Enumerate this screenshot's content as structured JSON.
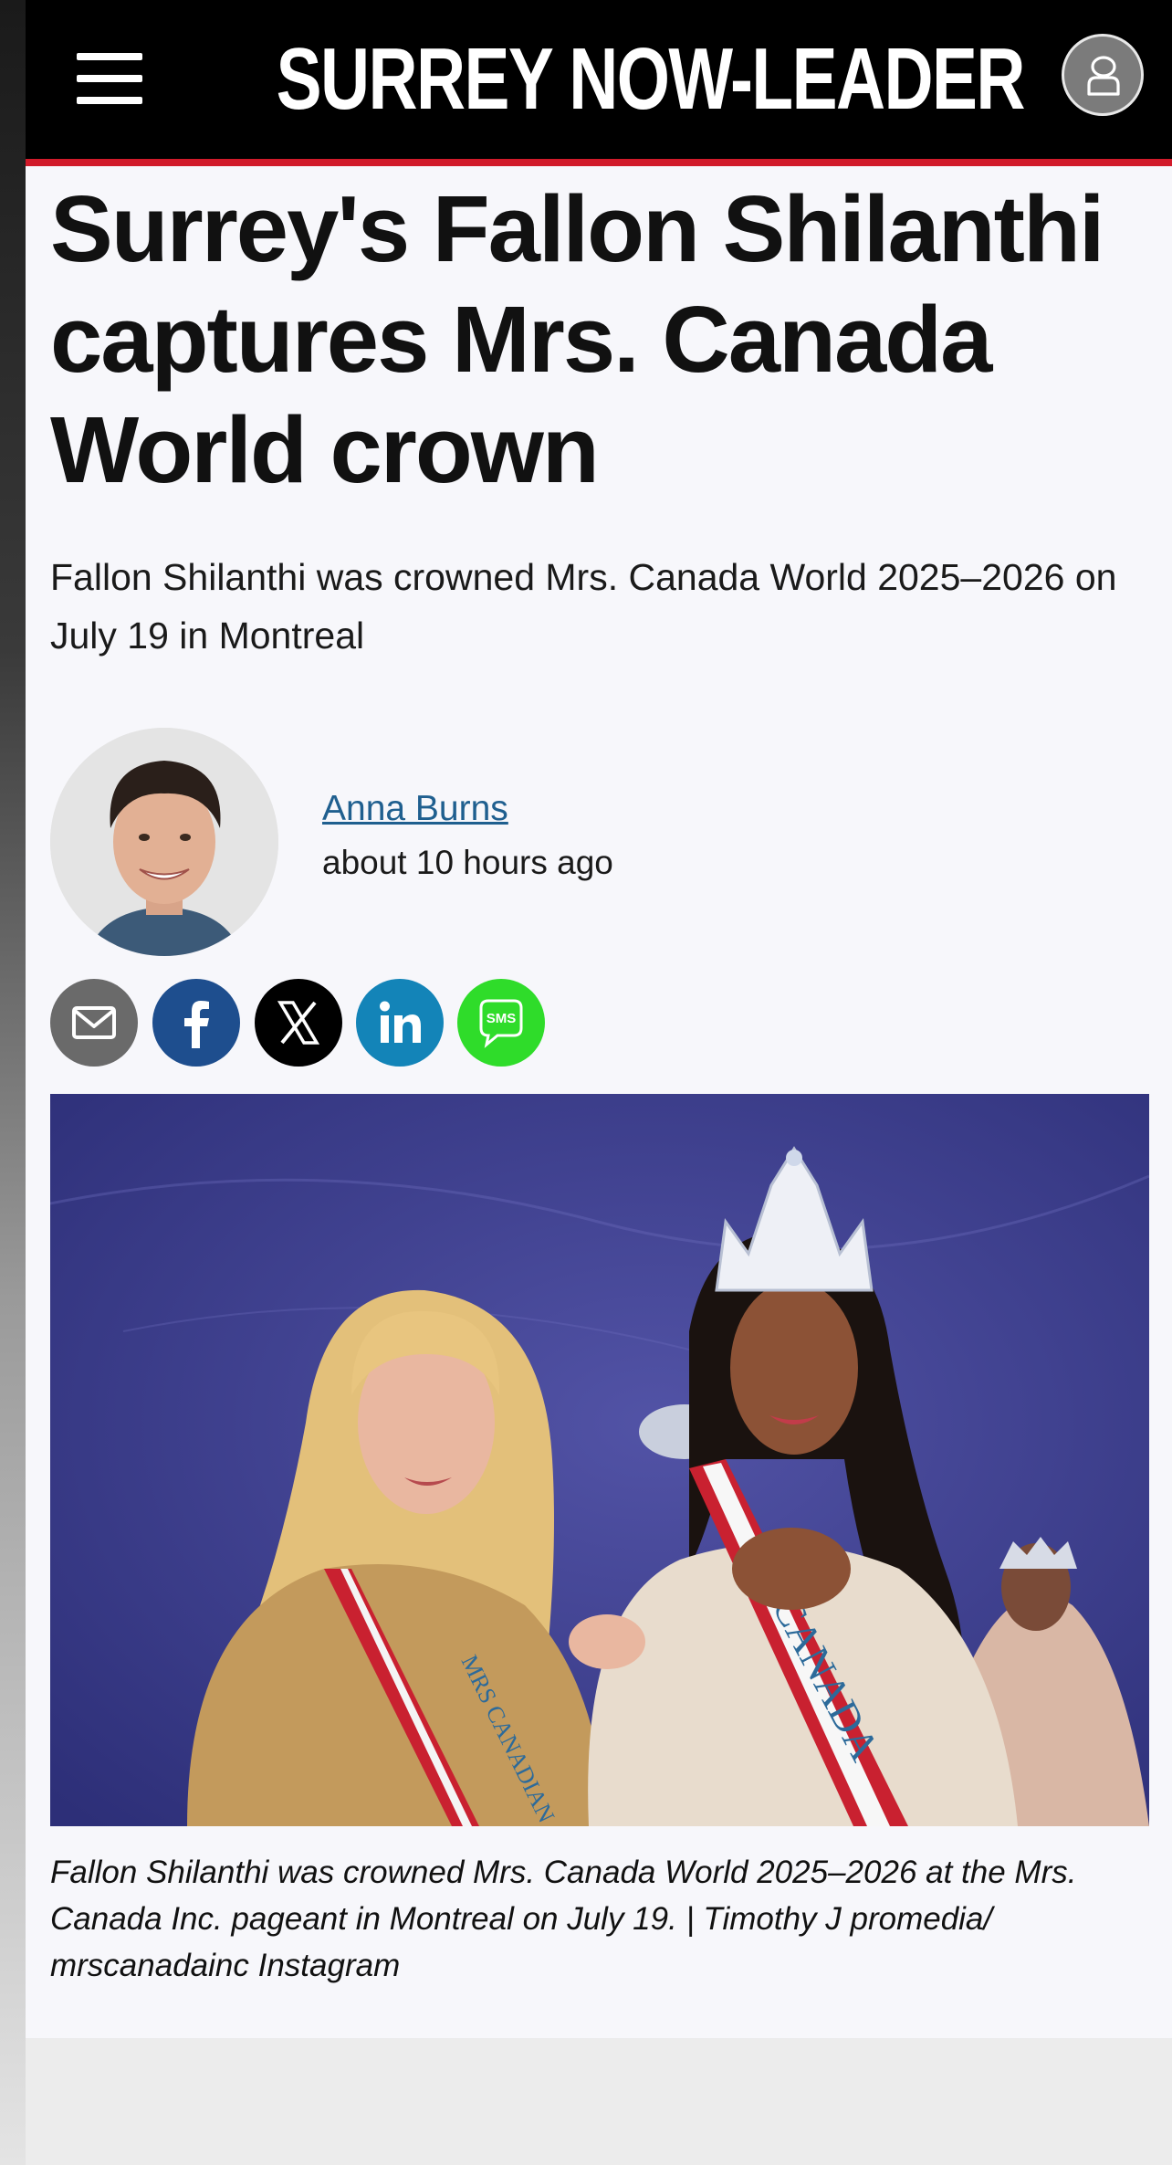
{
  "header": {
    "brand": "SURREY NOW-LEADER",
    "menu_icon": "hamburger-menu-icon",
    "account_icon": "user-account-icon"
  },
  "article": {
    "headline": "Surrey's Fallon Shilanthi captures Mrs. Canada World crown",
    "deck": "Fallon Shilanthi was crowned Mrs. Canada World 2025–2026 on July 19 in Montreal",
    "author": {
      "name": "Anna Burns",
      "time": "about 10 hours ago"
    },
    "share": [
      {
        "name": "email",
        "icon": "email-icon"
      },
      {
        "name": "facebook",
        "icon": "facebook-icon"
      },
      {
        "name": "x",
        "icon": "x-icon"
      },
      {
        "name": "linkedin",
        "icon": "linkedin-icon"
      },
      {
        "name": "sms",
        "icon": "sms-icon",
        "label": "SMS"
      }
    ],
    "photo": {
      "sash_text": "CANADA",
      "sash_text_left": "MRS CANADIAN"
    },
    "caption": "Fallon Shilanthi was crowned Mrs. Canada World 2025–2026 at the Mrs. Canada Inc. pageant in Montreal on July 19.  | Timothy J promedia/ mrscanadainc Instagram"
  },
  "colors": {
    "header_bg": "#000000",
    "header_rule": "#d11a2a",
    "link": "#1f5f8f",
    "facebook": "#1e4e8e",
    "linkedin": "#1384b8",
    "sms": "#2fdc2a"
  }
}
